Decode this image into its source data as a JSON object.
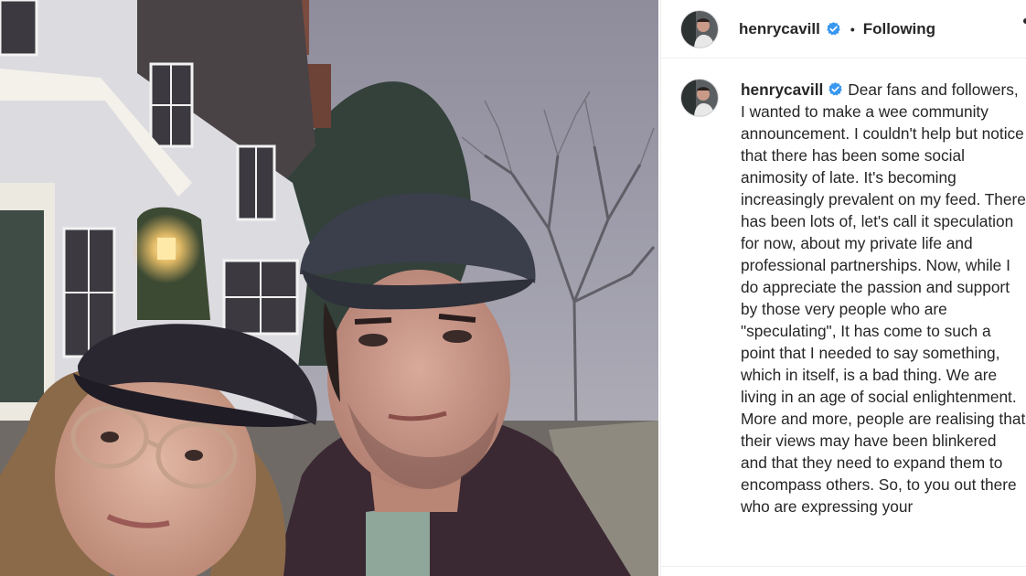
{
  "photo": {
    "alt": ""
  },
  "post_header": {
    "username": "henrycavill",
    "separator": "•",
    "follow_label": "Following",
    "verified_icon": "verified-badge-icon",
    "more_icon": "more-options-icon"
  },
  "caption": {
    "username": "henrycavill",
    "verified_icon": "verified-badge-icon",
    "text": "Dear fans and followers, I wanted to make a wee community announcement. I couldn't help but notice that there has been some social animosity of late. It's becoming increasingly prevalent on my feed. There has been lots of, let's call it speculation for now, about my private life and professional partnerships. Now, while I do appreciate the passion and support by those very people who are \"speculating\", It has come to such a point that I needed to say something, which in itself, is a bad thing. We are living in an age of social enlightenment. More and more, people are realising that their views may have been blinkered and that they need to expand them to encompass others. So, to you out there who are expressing your"
  },
  "colors": {
    "verified": "#3897f0",
    "text": "#262626",
    "border": "#efefef"
  }
}
